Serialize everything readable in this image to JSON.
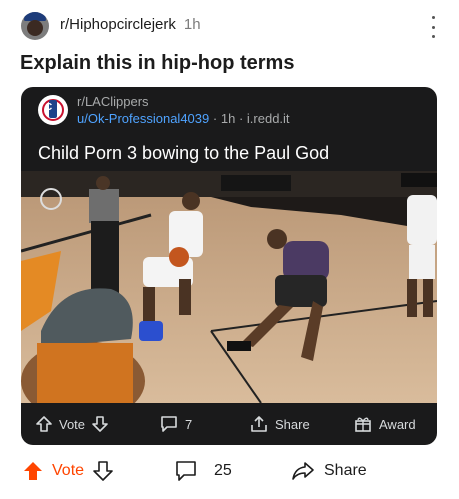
{
  "post": {
    "subreddit": "r/Hiphopcirclejerk",
    "age": "1h",
    "title": "Explain this in hip-hop terms"
  },
  "crosspost": {
    "subreddit": "r/LAClippers",
    "user": "u/Ok-Professional4039",
    "sep1": "·",
    "age": "1h",
    "sep2": "·",
    "domain": "i.redd.it",
    "title": "Child Porn 3 bowing to the Paul God",
    "actions": {
      "vote_label": "Vote",
      "comments": "7",
      "share_label": "Share",
      "award_label": "Award"
    }
  },
  "bottom_bar": {
    "vote_label": "Vote",
    "comments": "25",
    "share_label": "Share"
  },
  "colors": {
    "upvote_accent": "#ff4500",
    "link_blue": "#4fa3ff",
    "card_bg": "#1a1a1b"
  }
}
